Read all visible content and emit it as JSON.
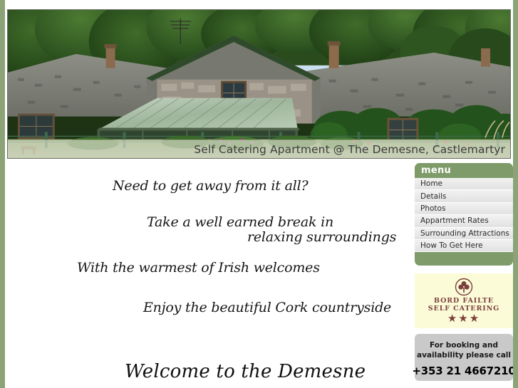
{
  "site": {
    "background_color": "#8ca378",
    "page_background": "#ffffff"
  },
  "header": {
    "caption": "Self Catering Apartment @ The Demesne, Castlemartyr",
    "photo_alt": "Stone cottage with slate roof, glass conservatory and ivy-covered walls set amongst trees and garden"
  },
  "main": {
    "taglines": [
      "Need to get away from it all?",
      "Take a well earned break in",
      "relaxing surroundings",
      "With the warmest of Irish welcomes",
      "Enjoy the beautiful Cork countryside"
    ],
    "welcome_heading": "Welcome to the Demesne"
  },
  "sidebar": {
    "menu": {
      "title": "menu",
      "header_color": "#7f9b69",
      "items": [
        {
          "label": "Home",
          "name": "sidebar-item-home"
        },
        {
          "label": "Details",
          "name": "sidebar-item-details"
        },
        {
          "label": "Photos",
          "name": "sidebar-item-photos"
        },
        {
          "label": "Appartment Rates",
          "name": "sidebar-item-appartment-rates"
        },
        {
          "label": "Surrounding Attractions",
          "name": "sidebar-item-surrounding-attractions"
        },
        {
          "label": "How To Get Here",
          "name": "sidebar-item-how-to-get-here"
        }
      ]
    },
    "logo": {
      "line1": "BORD FAILTE",
      "line2": "SELF CATERING",
      "stars": "★★★",
      "emblem": "shamrock-circle-icon",
      "color": "#7c3f3c",
      "background": "#fbfbd8"
    },
    "booking": {
      "line1": "For booking and",
      "line2": "availability please call",
      "phone": "+353 21 4667210",
      "background": "#c9c9c9"
    }
  }
}
